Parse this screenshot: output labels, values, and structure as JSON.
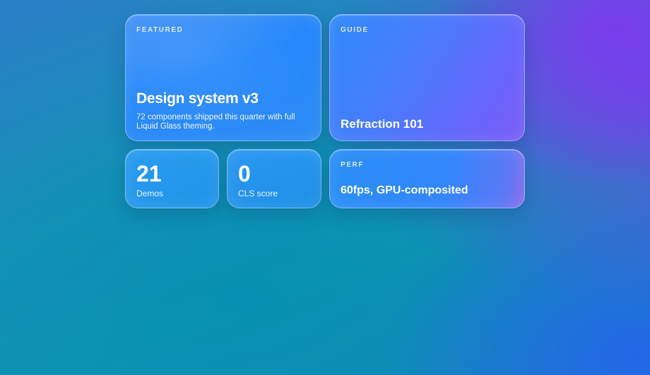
{
  "cards": {
    "featured": {
      "eyebrow": "FEATURED",
      "title": "Design system v3",
      "description": "72 components shipped this quarter with full Liquid Glass theming."
    },
    "guide": {
      "eyebrow": "GUIDE",
      "title": "Refraction 101"
    },
    "stats": [
      {
        "value": "21",
        "label": "Demos"
      },
      {
        "value": "0",
        "label": "CLS score"
      }
    ],
    "perf": {
      "eyebrow": "PERF",
      "title": "60fps, GPU-composited"
    }
  },
  "colors": {
    "background_top_right": "#7c3aed",
    "background_center": "#0891b2",
    "background_bottom_right": "#2563eb",
    "card_blue": "#2487fb",
    "card_violet": "#7a5ef5",
    "text": "#ffffff"
  }
}
